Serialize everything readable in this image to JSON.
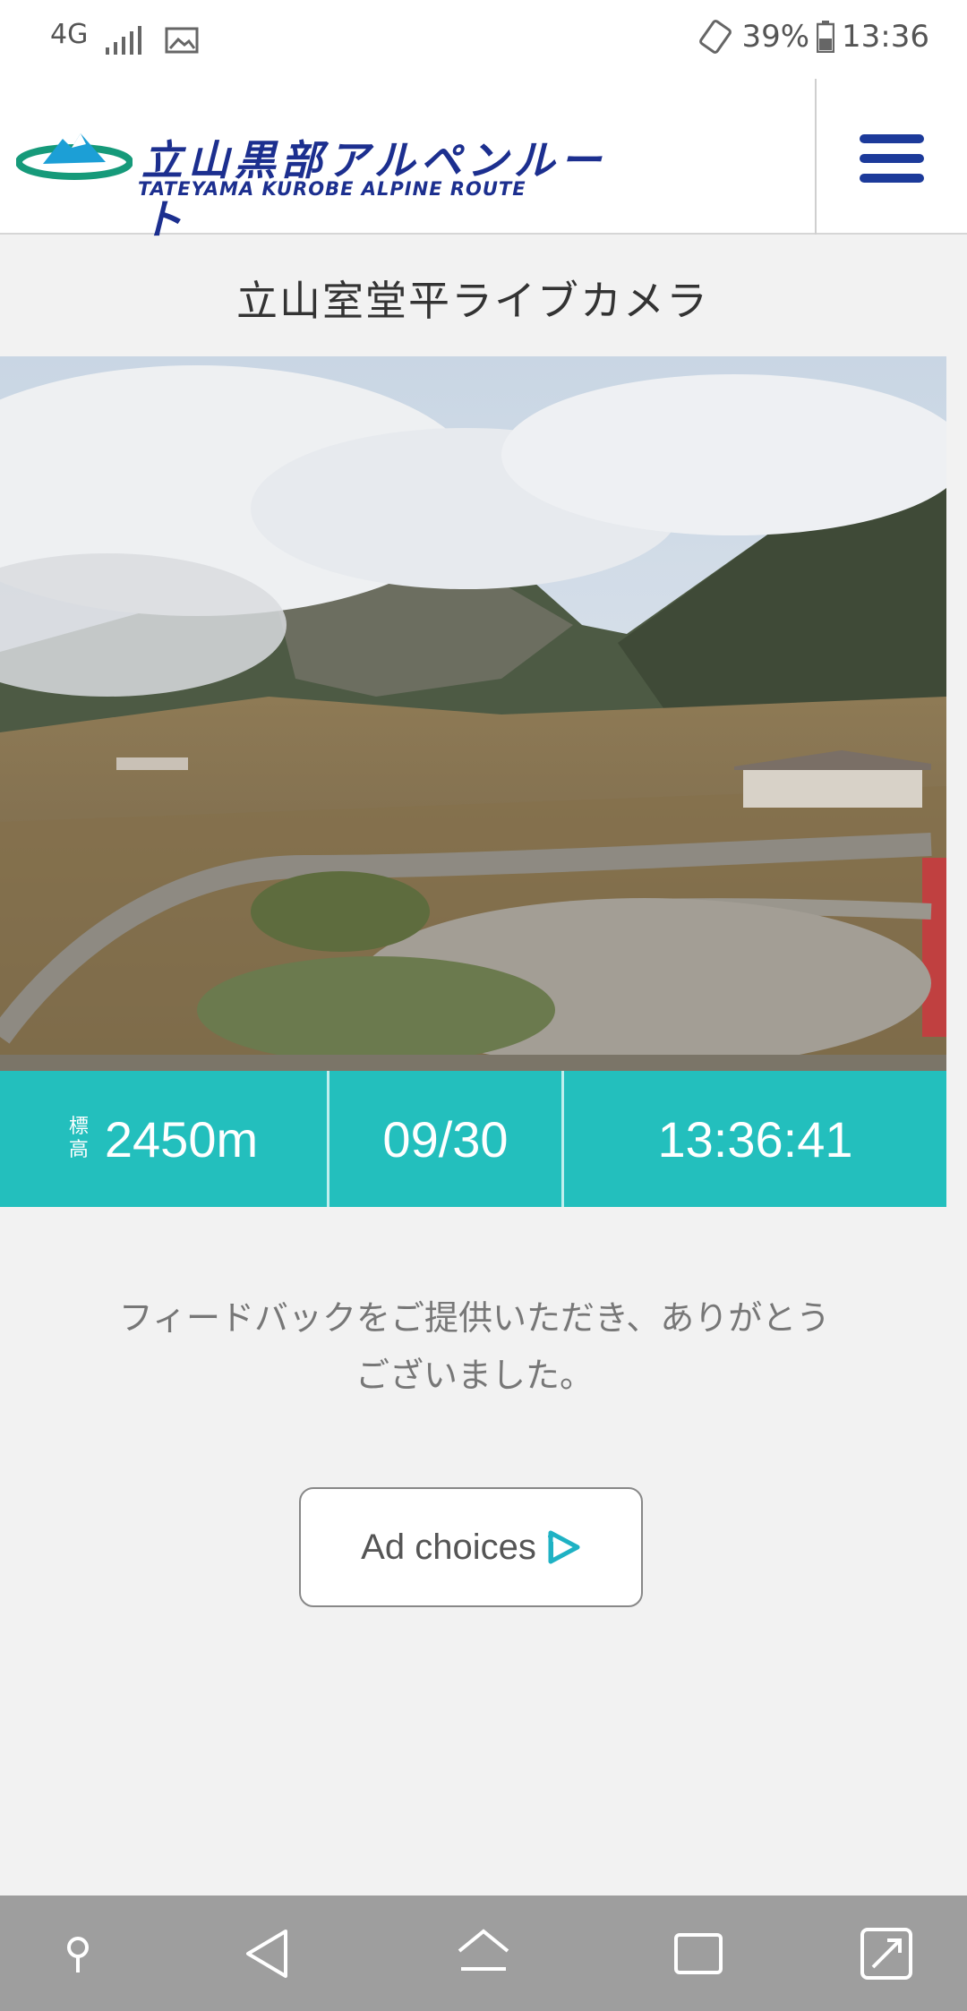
{
  "status_bar": {
    "network": "4G",
    "battery": "39%",
    "time": "13:36"
  },
  "header": {
    "logo_jp": "立山黒部アルペンルート",
    "logo_en": "TATEYAMA KUROBE ALPINE ROUTE"
  },
  "page": {
    "title": "立山室堂平ライブカメラ"
  },
  "camera_info": {
    "altitude_label_1": "標",
    "altitude_label_2": "高",
    "altitude": "2450m",
    "date": "09/30",
    "time": "13:36:41"
  },
  "feedback": {
    "line1": "フィードバックをご提供いただき、ありがとう",
    "line2": "ございました。"
  },
  "ad": {
    "label": "Ad choices"
  },
  "colors": {
    "accent_teal": "#23bfbd",
    "brand_blue": "#1c2f8f"
  }
}
